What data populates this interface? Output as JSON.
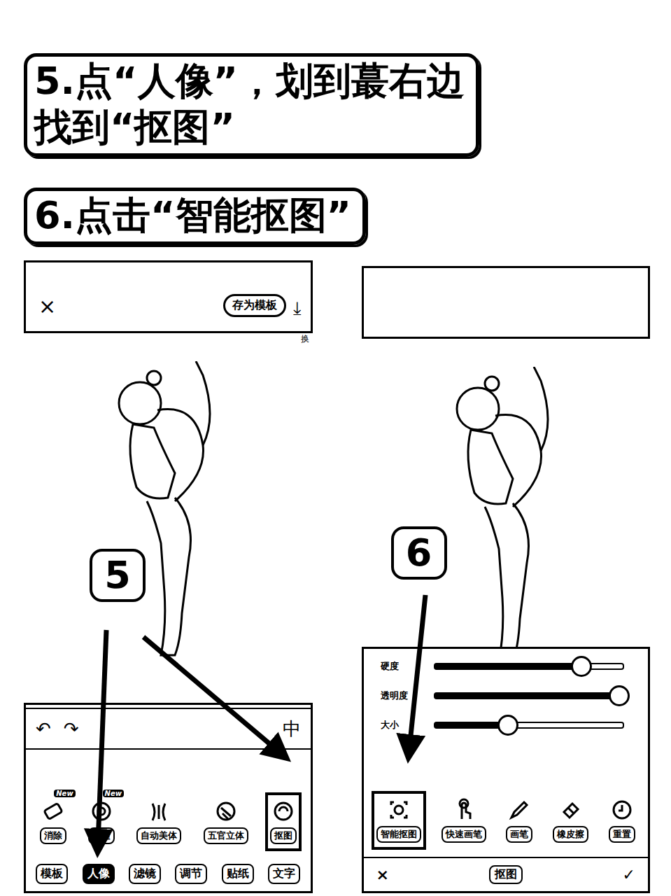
{
  "steps": [
    {
      "lines": [
        "5.点“人像”，划到蕞右边",
        "找到“抠图”"
      ]
    },
    {
      "lines": [
        "6.点击“智能抠图”"
      ]
    }
  ],
  "left_screen": {
    "top_bar": {
      "close": "×",
      "save_template": "存为模板",
      "download": "⤓",
      "corner": "换"
    },
    "badge": "5",
    "toolbar": {
      "undo": "↶",
      "redo": "↷",
      "right": "中"
    },
    "tools": [
      {
        "label": "消除",
        "badge": "New",
        "selected": false
      },
      {
        "label": "克隆",
        "badge": "New",
        "selected": false
      },
      {
        "label": "自动美体",
        "badge": "",
        "selected": false
      },
      {
        "label": "五官立体",
        "badge": "",
        "selected": false
      },
      {
        "label": "抠图",
        "badge": "",
        "selected": true
      }
    ],
    "tabs": [
      {
        "label": "模板",
        "selected": false
      },
      {
        "label": "人像",
        "selected": true
      },
      {
        "label": "滤镜",
        "selected": false
      },
      {
        "label": "调节",
        "selected": false
      },
      {
        "label": "贴纸",
        "selected": false
      },
      {
        "label": "文字",
        "selected": false
      }
    ]
  },
  "right_screen": {
    "badge": "6",
    "sliders": [
      {
        "label": "硬度",
        "level": 0.78
      },
      {
        "label": "透明度",
        "level": 0.98
      },
      {
        "label": "大小",
        "level": 0.39
      }
    ],
    "tools": [
      {
        "label": "智能抠图",
        "selected": true
      },
      {
        "label": "快速画笔",
        "selected": false
      },
      {
        "label": "画笔",
        "selected": false
      },
      {
        "label": "橡皮擦",
        "selected": false
      },
      {
        "label": "重置",
        "selected": false
      }
    ],
    "bottom_bar": {
      "close": "×",
      "title": "抠图",
      "confirm": "✓"
    }
  }
}
